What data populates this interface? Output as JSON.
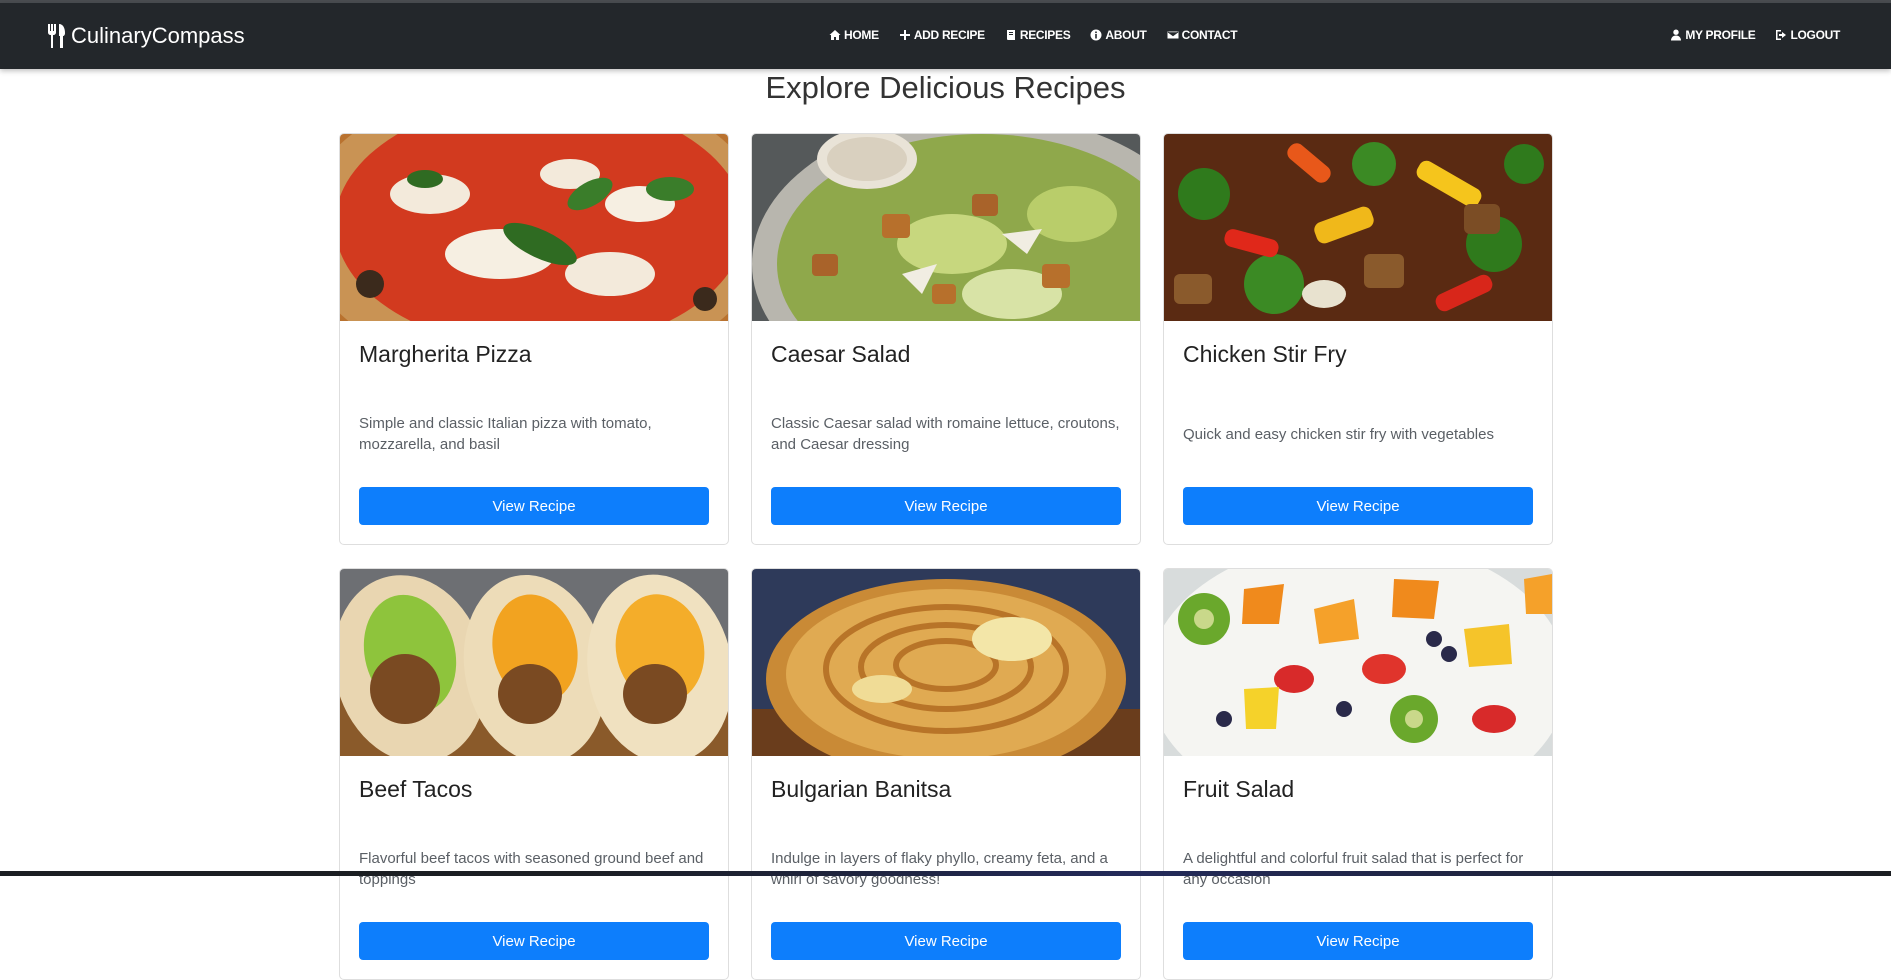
{
  "brand": {
    "name": "CulinaryCompass",
    "icon": "utensils-icon"
  },
  "nav": {
    "center": [
      {
        "label": "HOME",
        "icon": "home-icon"
      },
      {
        "label": "ADD RECIPE",
        "icon": "plus-icon"
      },
      {
        "label": "RECIPES",
        "icon": "book-icon"
      },
      {
        "label": "ABOUT",
        "icon": "info-icon"
      },
      {
        "label": "CONTACT",
        "icon": "envelope-icon"
      }
    ],
    "right": [
      {
        "label": "MY PROFILE",
        "icon": "user-icon"
      },
      {
        "label": "LOGOUT",
        "icon": "logout-icon"
      }
    ]
  },
  "page": {
    "heading": "Explore Delicious Recipes"
  },
  "recipes": [
    {
      "title": "Margherita Pizza",
      "description": "Simple and classic Italian pizza with tomato, mozzarella, and basil",
      "button": "View Recipe"
    },
    {
      "title": "Caesar Salad",
      "description": "Classic Caesar salad with romaine lettuce, croutons, and Caesar dressing",
      "button": "View Recipe"
    },
    {
      "title": "Chicken Stir Fry",
      "description": "Quick and easy chicken stir fry with vegetables",
      "button": "View Recipe"
    },
    {
      "title": "Beef Tacos",
      "description": "Flavorful beef tacos with seasoned ground beef and toppings",
      "button": "View Recipe"
    },
    {
      "title": "Bulgarian Banitsa",
      "description": "Indulge in layers of flaky phyllo, creamy feta, and a whirl of savory goodness!",
      "button": "View Recipe"
    },
    {
      "title": "Fruit Salad",
      "description": "A delightful and colorful fruit salad that is perfect for any occasion",
      "button": "View Recipe"
    }
  ],
  "colors": {
    "navbar": "#23272b",
    "primary_button": "#0d7efc",
    "background": "#ffffff"
  }
}
